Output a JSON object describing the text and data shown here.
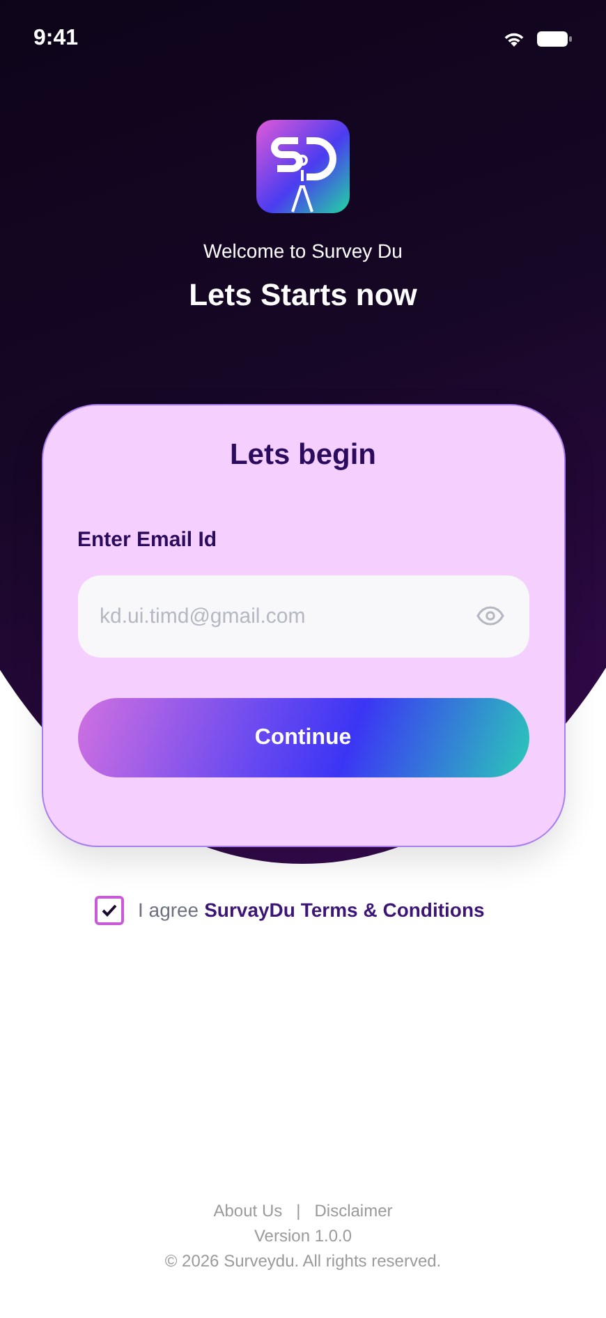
{
  "status_bar": {
    "time": "9:41"
  },
  "header": {
    "subtitle": "Welcome to Survey Du",
    "title": "Lets Starts now"
  },
  "card": {
    "title": "Lets begin",
    "email": {
      "label": "Enter Email Id",
      "placeholder": "kd.ui.timd@gmail.com"
    },
    "button": "Continue"
  },
  "agreement": {
    "checked": true,
    "text": "I agree",
    "link": "SurvayDu Terms & Conditions"
  },
  "footer": {
    "links": [
      "About Us",
      "Disclaimer"
    ],
    "separator": "|",
    "version": "Version 1.0.0",
    "copyright": "© 2026 Surveydu. All rights reserved."
  }
}
